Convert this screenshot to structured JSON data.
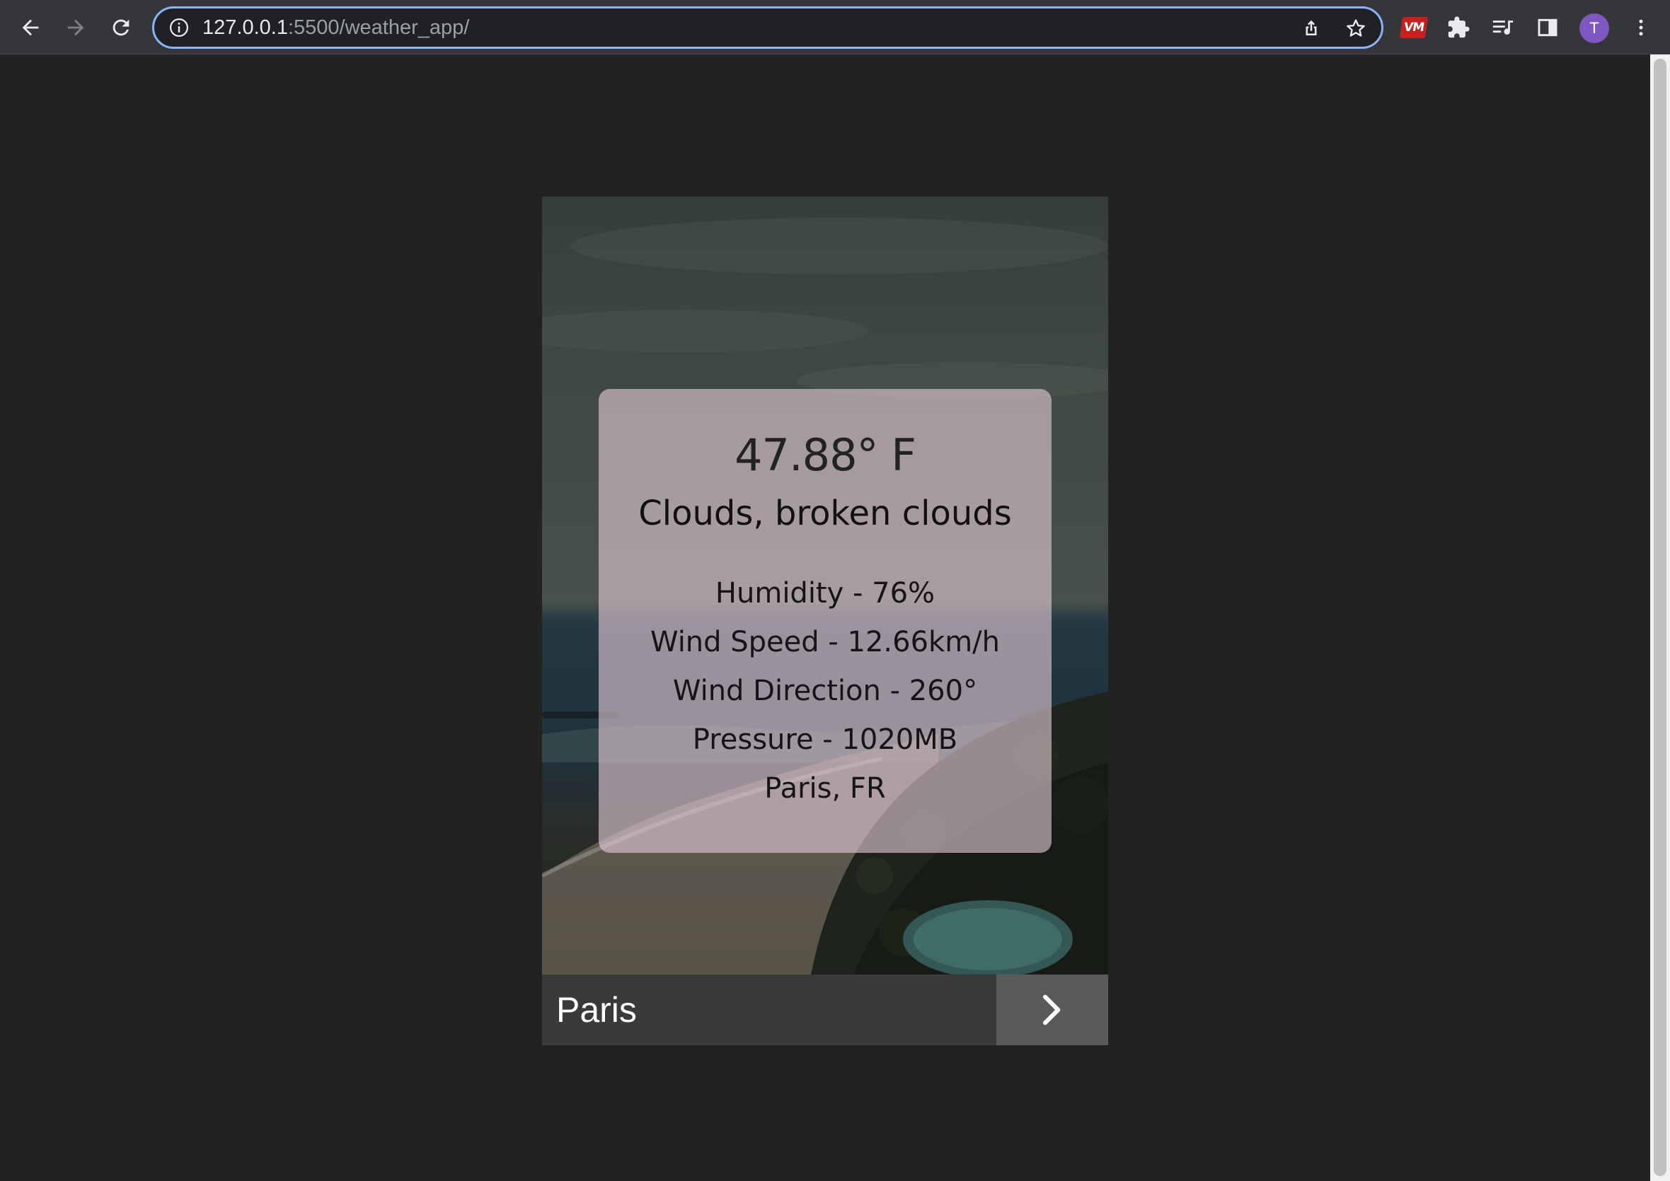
{
  "browser": {
    "url_host": "127.0.0.1",
    "url_path": ":5500/weather_app/",
    "profile_initial": "T",
    "extension_badge": "VM",
    "accent_color": "#8ab4f8",
    "avatar_color": "#7e57c2"
  },
  "weather": {
    "temperature": "47.88° F",
    "description": "Clouds, broken clouds",
    "humidity": "Humidity - 76%",
    "wind_speed": "Wind Speed - 12.66km/h",
    "wind_direction": "Wind Direction - 260°",
    "pressure": "Pressure - 1020MB",
    "location": "Paris, FR"
  },
  "search": {
    "value": "Paris",
    "button_icon": "chevron-right-icon"
  },
  "colors": {
    "page_background": "#222222",
    "panel_background": "rgba(228, 203, 214, 0.62)",
    "search_bar": "#3a3a3a",
    "search_button": "#5a5a5a"
  }
}
